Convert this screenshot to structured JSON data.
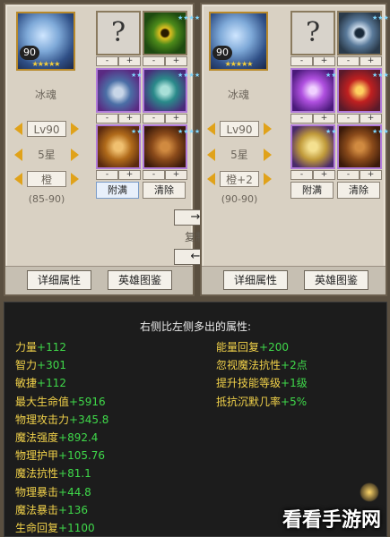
{
  "left": {
    "hero_name": "冰魂",
    "portrait_level": "90",
    "portrait_stars": "★★★★★",
    "level_text": "Lv90",
    "stars_text": "5星",
    "quality_text": "橙",
    "range_text": "(85-90)",
    "attach_label": "附满",
    "clear_label": "清除",
    "detail_label": "详细属性",
    "atlas_label": "英雄图鉴",
    "slot1_text": "?"
  },
  "right": {
    "hero_name": "冰魂",
    "portrait_level": "90",
    "portrait_stars": "★★★★★",
    "level_text": "Lv90",
    "stars_text": "5星",
    "quality_text": "橙+2",
    "range_text": "(90-90)",
    "attach_label": "附满",
    "clear_label": "清除",
    "detail_label": "详细属性",
    "atlas_label": "英雄图鉴",
    "slot1_text": "?"
  },
  "common": {
    "minus": "-",
    "plus": "+",
    "gear_stars": "★★★★★"
  },
  "middle": {
    "copy_right": "→",
    "copy_label": "复制",
    "copy_left": "←"
  },
  "attributes": {
    "title": "右侧比左侧多出的属性:",
    "left_column": [
      {
        "name": "力量",
        "value": "+112"
      },
      {
        "name": "智力",
        "value": "+301"
      },
      {
        "name": "敏捷",
        "value": "+112"
      },
      {
        "name": "最大生命值",
        "value": "+5916"
      },
      {
        "name": "物理攻击力",
        "value": "+345.8"
      },
      {
        "name": "魔法强度",
        "value": "+892.4"
      },
      {
        "name": "物理护甲",
        "value": "+105.76"
      },
      {
        "name": "魔法抗性",
        "value": "+81.1"
      },
      {
        "name": "物理暴击",
        "value": "+44.8"
      },
      {
        "name": "魔法暴击",
        "value": "+136"
      },
      {
        "name": "生命回复",
        "value": "+1100"
      }
    ],
    "right_column": [
      {
        "name": "能量回复",
        "value": "+200"
      },
      {
        "name": "忽视魔法抗性",
        "value": "+2点"
      },
      {
        "name": "提升技能等级",
        "value": "+1级"
      },
      {
        "name": "抵抗沉默几率",
        "value": "+5%"
      }
    ]
  },
  "watermark": "看看手游网",
  "colors": {
    "panel_bg": "#d9d1c3",
    "attr_bg": "#1c1c1c",
    "attr_name": "#f2d24a",
    "attr_value": "#3fd94a",
    "arrow": "#e0a21a"
  }
}
